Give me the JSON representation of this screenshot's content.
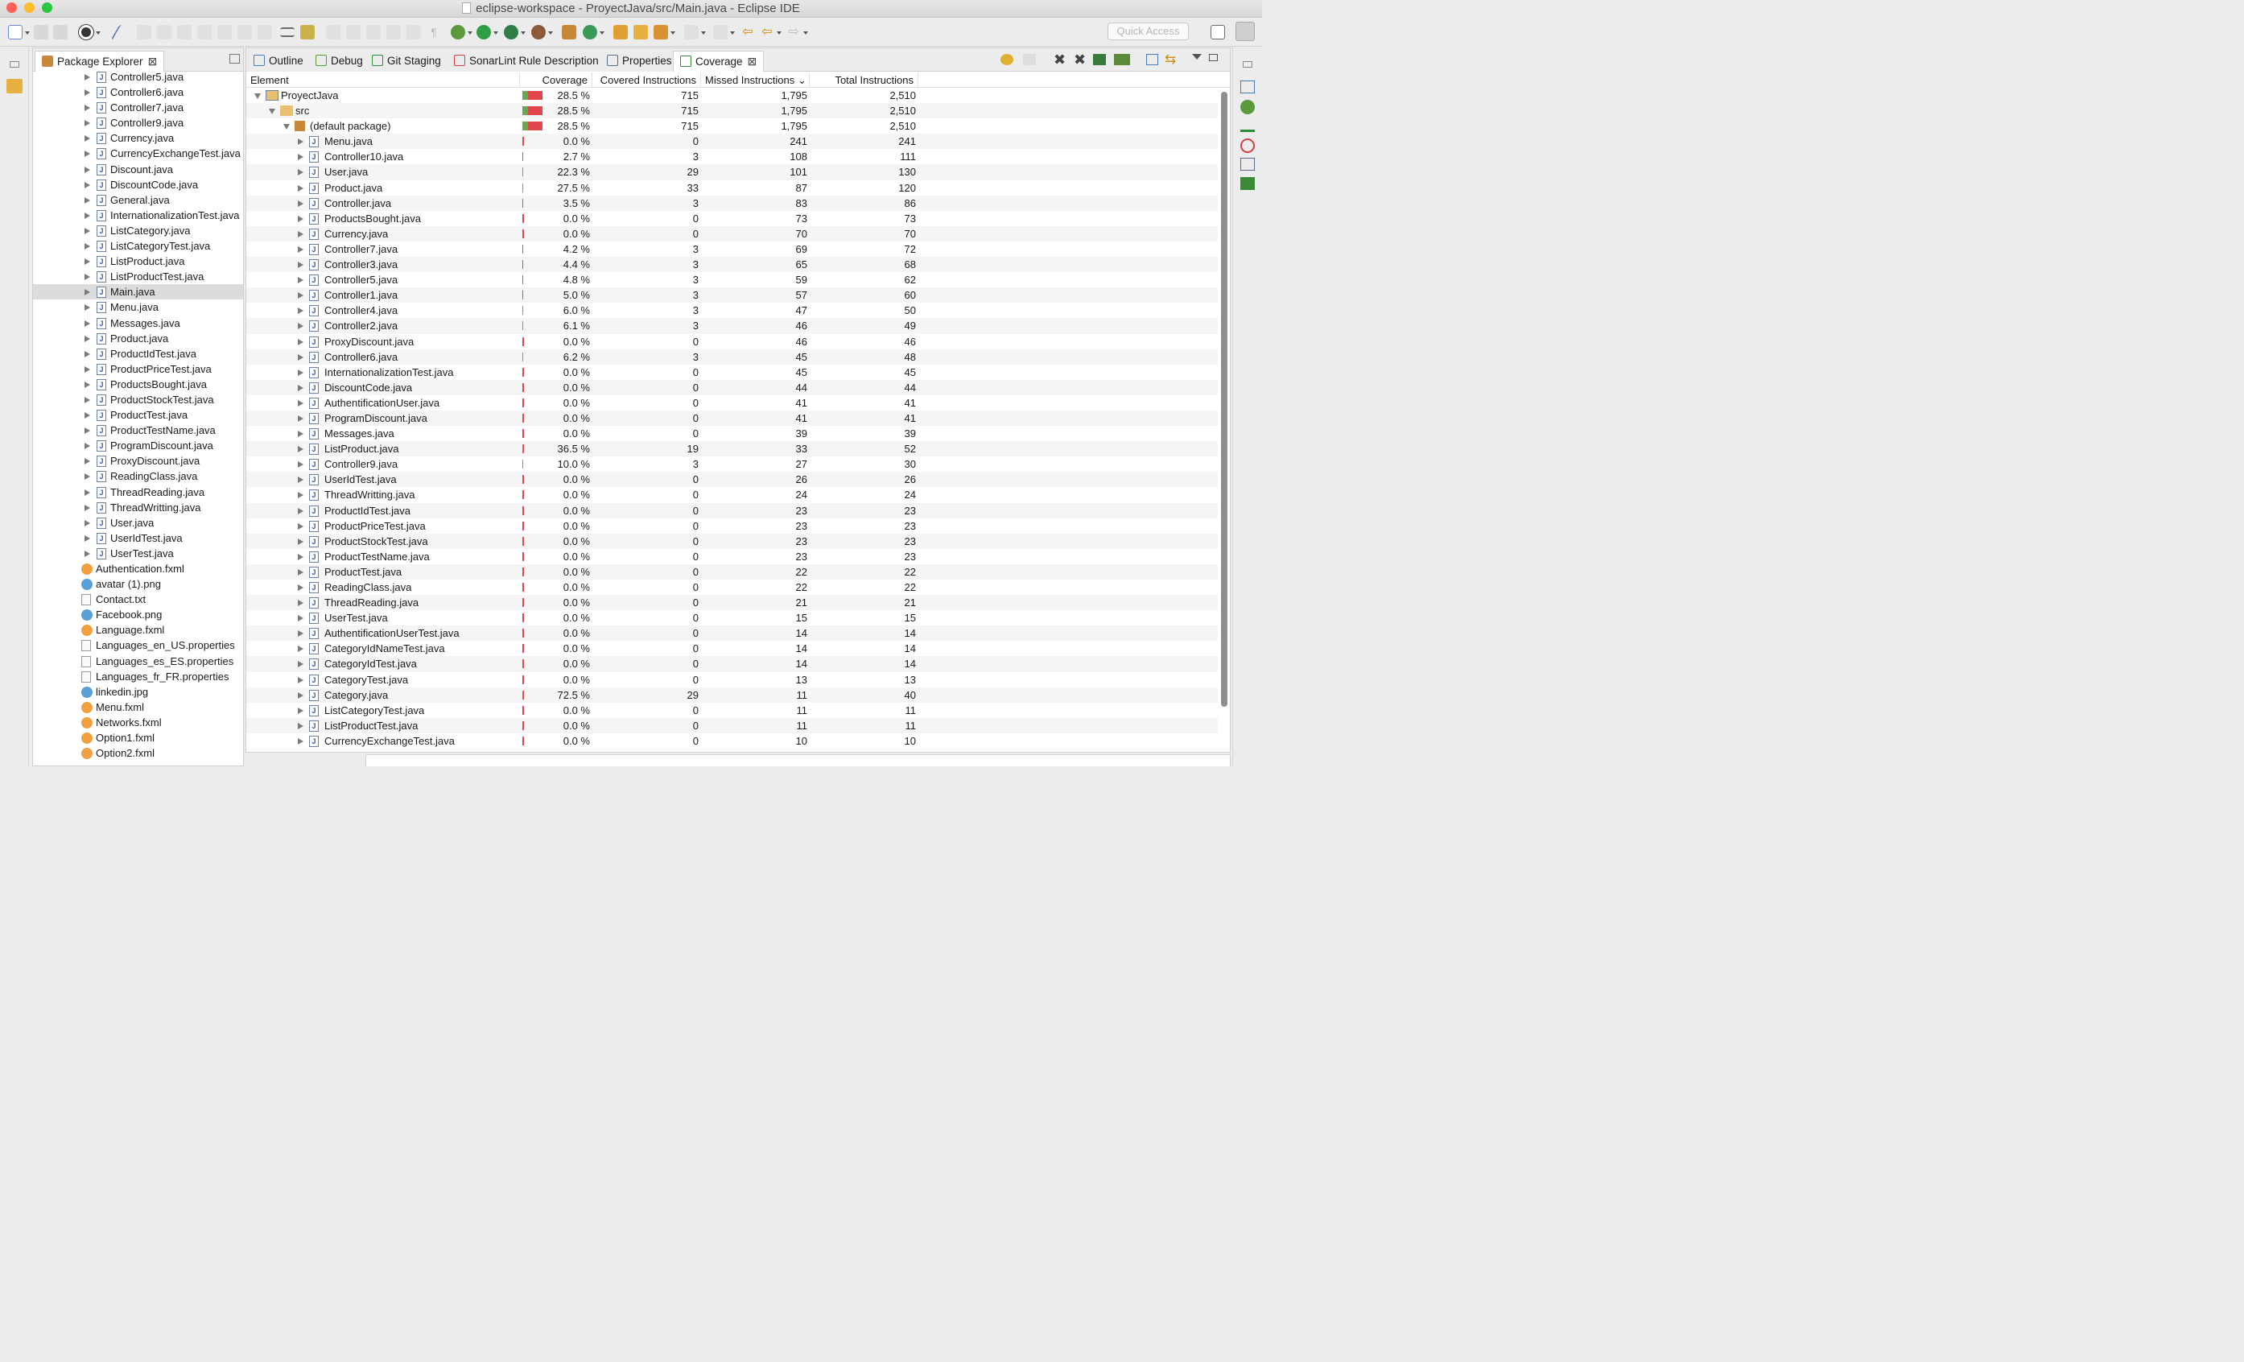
{
  "window": {
    "title": "eclipse-workspace - ProyectJava/src/Main.java - Eclipse IDE"
  },
  "colors": {
    "close": "#fe5f57",
    "minimize": "#febc2e",
    "zoom": "#28c840",
    "bar_red": "#e0474c",
    "bar_green": "#6aa84f"
  },
  "toolbar": {
    "quick_access": "Quick Access"
  },
  "package_explorer": {
    "tab_label": "Package Explorer",
    "items": [
      {
        "label": "Controller5.java",
        "kind": "java",
        "level": 1
      },
      {
        "label": "Controller6.java",
        "kind": "java",
        "level": 1
      },
      {
        "label": "Controller7.java",
        "kind": "java",
        "level": 1
      },
      {
        "label": "Controller9.java",
        "kind": "java",
        "level": 1
      },
      {
        "label": "Currency.java",
        "kind": "java",
        "level": 1
      },
      {
        "label": "CurrencyExchangeTest.java",
        "kind": "java",
        "level": 1
      },
      {
        "label": "Discount.java",
        "kind": "java",
        "level": 1
      },
      {
        "label": "DiscountCode.java",
        "kind": "java",
        "level": 1
      },
      {
        "label": "General.java",
        "kind": "java",
        "level": 1
      },
      {
        "label": "InternationalizationTest.java",
        "kind": "java",
        "level": 1
      },
      {
        "label": "ListCategory.java",
        "kind": "java",
        "level": 1
      },
      {
        "label": "ListCategoryTest.java",
        "kind": "java",
        "level": 1
      },
      {
        "label": "ListProduct.java",
        "kind": "java",
        "level": 1
      },
      {
        "label": "ListProductTest.java",
        "kind": "java",
        "level": 1
      },
      {
        "label": "Main.java",
        "kind": "java",
        "level": 1,
        "selected": true
      },
      {
        "label": "Menu.java",
        "kind": "java",
        "level": 1
      },
      {
        "label": "Messages.java",
        "kind": "java",
        "level": 1
      },
      {
        "label": "Product.java",
        "kind": "java",
        "level": 1
      },
      {
        "label": "ProductIdTest.java",
        "kind": "java",
        "level": 1
      },
      {
        "label": "ProductPriceTest.java",
        "kind": "java",
        "level": 1
      },
      {
        "label": "ProductsBought.java",
        "kind": "java",
        "level": 1
      },
      {
        "label": "ProductStockTest.java",
        "kind": "java",
        "level": 1
      },
      {
        "label": "ProductTest.java",
        "kind": "java",
        "level": 1
      },
      {
        "label": "ProductTestName.java",
        "kind": "java",
        "level": 1
      },
      {
        "label": "ProgramDiscount.java",
        "kind": "java",
        "level": 1
      },
      {
        "label": "ProxyDiscount.java",
        "kind": "java",
        "level": 1
      },
      {
        "label": "ReadingClass.java",
        "kind": "java",
        "level": 1
      },
      {
        "label": "ThreadReading.java",
        "kind": "java",
        "level": 1
      },
      {
        "label": "ThreadWritting.java",
        "kind": "java",
        "level": 1
      },
      {
        "label": "User.java",
        "kind": "java",
        "level": 1
      },
      {
        "label": "UserIdTest.java",
        "kind": "java",
        "level": 1
      },
      {
        "label": "UserTest.java",
        "kind": "java",
        "level": 1
      },
      {
        "label": "Authentication.fxml",
        "kind": "fxml",
        "level": 0
      },
      {
        "label": "avatar (1).png",
        "kind": "image",
        "level": 0
      },
      {
        "label": "Contact.txt",
        "kind": "text",
        "level": 0
      },
      {
        "label": "Facebook.png",
        "kind": "image",
        "level": 0
      },
      {
        "label": "Language.fxml",
        "kind": "fxml",
        "level": 0
      },
      {
        "label": "Languages_en_US.properties",
        "kind": "text",
        "level": 0
      },
      {
        "label": "Languages_es_ES.properties",
        "kind": "text",
        "level": 0
      },
      {
        "label": "Languages_fr_FR.properties",
        "kind": "text",
        "level": 0
      },
      {
        "label": "linkedin.jpg",
        "kind": "image",
        "level": 0
      },
      {
        "label": "Menu.fxml",
        "kind": "fxml",
        "level": 0
      },
      {
        "label": "Networks.fxml",
        "kind": "fxml",
        "level": 0
      },
      {
        "label": "Option1.fxml",
        "kind": "fxml",
        "level": 0
      },
      {
        "label": "Option2.fxml",
        "kind": "fxml",
        "level": 0
      }
    ]
  },
  "view_tabs": [
    {
      "label": "Outline",
      "icon": "outline-icon"
    },
    {
      "label": "Debug",
      "icon": "debug-icon"
    },
    {
      "label": "Git Staging",
      "icon": "git-staging-icon"
    },
    {
      "label": "SonarLint Rule Description",
      "icon": "sonarlint-icon"
    },
    {
      "label": "Properties",
      "icon": "properties-icon"
    },
    {
      "label": "Coverage",
      "icon": "coverage-icon",
      "active": true
    }
  ],
  "coverage": {
    "columns": [
      "Element",
      "Coverage",
      "Covered Instructions",
      "Missed Instructions",
      "Total Instructions"
    ],
    "sort_column": "Missed Instructions",
    "rows": [
      {
        "name": "ProyectJava",
        "kind": "project",
        "depth": 0,
        "expanded": true,
        "coverage": "28.5 %",
        "pct": 28.5,
        "covered": "715",
        "missed": "1,795",
        "total": "2,510",
        "total_n": 2510
      },
      {
        "name": "src",
        "kind": "folder",
        "depth": 1,
        "expanded": true,
        "coverage": "28.5 %",
        "pct": 28.5,
        "covered": "715",
        "missed": "1,795",
        "total": "2,510",
        "total_n": 2510
      },
      {
        "name": "(default package)",
        "kind": "package",
        "depth": 2,
        "expanded": true,
        "coverage": "28.5 %",
        "pct": 28.5,
        "covered": "715",
        "missed": "1,795",
        "total": "2,510",
        "total_n": 2510
      },
      {
        "name": "Menu.java",
        "kind": "java",
        "depth": 3,
        "coverage": "0.0 %",
        "pct": 0,
        "covered": "0",
        "missed": "241",
        "total": "241",
        "total_n": 241
      },
      {
        "name": "Controller10.java",
        "kind": "java",
        "depth": 3,
        "coverage": "2.7 %",
        "pct": 2.7,
        "covered": "3",
        "missed": "108",
        "total": "111",
        "total_n": 111
      },
      {
        "name": "User.java",
        "kind": "java",
        "depth": 3,
        "coverage": "22.3 %",
        "pct": 22.3,
        "covered": "29",
        "missed": "101",
        "total": "130",
        "total_n": 130
      },
      {
        "name": "Product.java",
        "kind": "java",
        "depth": 3,
        "coverage": "27.5 %",
        "pct": 27.5,
        "covered": "33",
        "missed": "87",
        "total": "120",
        "total_n": 120
      },
      {
        "name": "Controller.java",
        "kind": "java",
        "depth": 3,
        "coverage": "3.5 %",
        "pct": 3.5,
        "covered": "3",
        "missed": "83",
        "total": "86",
        "total_n": 86
      },
      {
        "name": "ProductsBought.java",
        "kind": "java",
        "depth": 3,
        "coverage": "0.0 %",
        "pct": 0,
        "covered": "0",
        "missed": "73",
        "total": "73",
        "total_n": 73
      },
      {
        "name": "Currency.java",
        "kind": "java",
        "depth": 3,
        "coverage": "0.0 %",
        "pct": 0,
        "covered": "0",
        "missed": "70",
        "total": "70",
        "total_n": 70
      },
      {
        "name": "Controller7.java",
        "kind": "java",
        "depth": 3,
        "coverage": "4.2 %",
        "pct": 4.2,
        "covered": "3",
        "missed": "69",
        "total": "72",
        "total_n": 72
      },
      {
        "name": "Controller3.java",
        "kind": "java",
        "depth": 3,
        "coverage": "4.4 %",
        "pct": 4.4,
        "covered": "3",
        "missed": "65",
        "total": "68",
        "total_n": 68
      },
      {
        "name": "Controller5.java",
        "kind": "java",
        "depth": 3,
        "coverage": "4.8 %",
        "pct": 4.8,
        "covered": "3",
        "missed": "59",
        "total": "62",
        "total_n": 62
      },
      {
        "name": "Controller1.java",
        "kind": "java",
        "depth": 3,
        "coverage": "5.0 %",
        "pct": 5.0,
        "covered": "3",
        "missed": "57",
        "total": "60",
        "total_n": 60
      },
      {
        "name": "Controller4.java",
        "kind": "java",
        "depth": 3,
        "coverage": "6.0 %",
        "pct": 6.0,
        "covered": "3",
        "missed": "47",
        "total": "50",
        "total_n": 50
      },
      {
        "name": "Controller2.java",
        "kind": "java",
        "depth": 3,
        "coverage": "6.1 %",
        "pct": 6.1,
        "covered": "3",
        "missed": "46",
        "total": "49",
        "total_n": 49
      },
      {
        "name": "ProxyDiscount.java",
        "kind": "java",
        "depth": 3,
        "coverage": "0.0 %",
        "pct": 0,
        "covered": "0",
        "missed": "46",
        "total": "46",
        "total_n": 46
      },
      {
        "name": "Controller6.java",
        "kind": "java",
        "depth": 3,
        "coverage": "6.2 %",
        "pct": 6.2,
        "covered": "3",
        "missed": "45",
        "total": "48",
        "total_n": 48
      },
      {
        "name": "InternationalizationTest.java",
        "kind": "java",
        "depth": 3,
        "coverage": "0.0 %",
        "pct": 0,
        "covered": "0",
        "missed": "45",
        "total": "45",
        "total_n": 45
      },
      {
        "name": "DiscountCode.java",
        "kind": "java",
        "depth": 3,
        "coverage": "0.0 %",
        "pct": 0,
        "covered": "0",
        "missed": "44",
        "total": "44",
        "total_n": 44
      },
      {
        "name": "AuthentificationUser.java",
        "kind": "java",
        "depth": 3,
        "coverage": "0.0 %",
        "pct": 0,
        "covered": "0",
        "missed": "41",
        "total": "41",
        "total_n": 41
      },
      {
        "name": "ProgramDiscount.java",
        "kind": "java",
        "depth": 3,
        "coverage": "0.0 %",
        "pct": 0,
        "covered": "0",
        "missed": "41",
        "total": "41",
        "total_n": 41
      },
      {
        "name": "Messages.java",
        "kind": "java",
        "depth": 3,
        "coverage": "0.0 %",
        "pct": 0,
        "covered": "0",
        "missed": "39",
        "total": "39",
        "total_n": 39
      },
      {
        "name": "ListProduct.java",
        "kind": "java",
        "depth": 3,
        "coverage": "36.5 %",
        "pct": 36.5,
        "covered": "19",
        "missed": "33",
        "total": "52",
        "total_n": 52
      },
      {
        "name": "Controller9.java",
        "kind": "java",
        "depth": 3,
        "coverage": "10.0 %",
        "pct": 10.0,
        "covered": "3",
        "missed": "27",
        "total": "30",
        "total_n": 30
      },
      {
        "name": "UserIdTest.java",
        "kind": "java",
        "depth": 3,
        "coverage": "0.0 %",
        "pct": 0,
        "covered": "0",
        "missed": "26",
        "total": "26",
        "total_n": 26
      },
      {
        "name": "ThreadWritting.java",
        "kind": "java",
        "depth": 3,
        "coverage": "0.0 %",
        "pct": 0,
        "covered": "0",
        "missed": "24",
        "total": "24",
        "total_n": 24
      },
      {
        "name": "ProductIdTest.java",
        "kind": "java",
        "depth": 3,
        "coverage": "0.0 %",
        "pct": 0,
        "covered": "0",
        "missed": "23",
        "total": "23",
        "total_n": 23
      },
      {
        "name": "ProductPriceTest.java",
        "kind": "java",
        "depth": 3,
        "coverage": "0.0 %",
        "pct": 0,
        "covered": "0",
        "missed": "23",
        "total": "23",
        "total_n": 23
      },
      {
        "name": "ProductStockTest.java",
        "kind": "java",
        "depth": 3,
        "coverage": "0.0 %",
        "pct": 0,
        "covered": "0",
        "missed": "23",
        "total": "23",
        "total_n": 23
      },
      {
        "name": "ProductTestName.java",
        "kind": "java",
        "depth": 3,
        "coverage": "0.0 %",
        "pct": 0,
        "covered": "0",
        "missed": "23",
        "total": "23",
        "total_n": 23
      },
      {
        "name": "ProductTest.java",
        "kind": "java",
        "depth": 3,
        "coverage": "0.0 %",
        "pct": 0,
        "covered": "0",
        "missed": "22",
        "total": "22",
        "total_n": 22
      },
      {
        "name": "ReadingClass.java",
        "kind": "java",
        "depth": 3,
        "coverage": "0.0 %",
        "pct": 0,
        "covered": "0",
        "missed": "22",
        "total": "22",
        "total_n": 22
      },
      {
        "name": "ThreadReading.java",
        "kind": "java",
        "depth": 3,
        "coverage": "0.0 %",
        "pct": 0,
        "covered": "0",
        "missed": "21",
        "total": "21",
        "total_n": 21
      },
      {
        "name": "UserTest.java",
        "kind": "java",
        "depth": 3,
        "coverage": "0.0 %",
        "pct": 0,
        "covered": "0",
        "missed": "15",
        "total": "15",
        "total_n": 15
      },
      {
        "name": "AuthentificationUserTest.java",
        "kind": "java",
        "depth": 3,
        "coverage": "0.0 %",
        "pct": 0,
        "covered": "0",
        "missed": "14",
        "total": "14",
        "total_n": 14
      },
      {
        "name": "CategoryIdNameTest.java",
        "kind": "java",
        "depth": 3,
        "coverage": "0.0 %",
        "pct": 0,
        "covered": "0",
        "missed": "14",
        "total": "14",
        "total_n": 14
      },
      {
        "name": "CategoryIdTest.java",
        "kind": "java",
        "depth": 3,
        "coverage": "0.0 %",
        "pct": 0,
        "covered": "0",
        "missed": "14",
        "total": "14",
        "total_n": 14
      },
      {
        "name": "CategoryTest.java",
        "kind": "java",
        "depth": 3,
        "coverage": "0.0 %",
        "pct": 0,
        "covered": "0",
        "missed": "13",
        "total": "13",
        "total_n": 13
      },
      {
        "name": "Category.java",
        "kind": "java",
        "depth": 3,
        "coverage": "72.5 %",
        "pct": 72.5,
        "covered": "29",
        "missed": "11",
        "total": "40",
        "total_n": 40
      },
      {
        "name": "ListCategoryTest.java",
        "kind": "java",
        "depth": 3,
        "coverage": "0.0 %",
        "pct": 0,
        "covered": "0",
        "missed": "11",
        "total": "11",
        "total_n": 11
      },
      {
        "name": "ListProductTest.java",
        "kind": "java",
        "depth": 3,
        "coverage": "0.0 %",
        "pct": 0,
        "covered": "0",
        "missed": "11",
        "total": "11",
        "total_n": 11
      },
      {
        "name": "CurrencyExchangeTest.java",
        "kind": "java",
        "depth": 3,
        "coverage": "0.0 %",
        "pct": 0,
        "covered": "0",
        "missed": "10",
        "total": "10",
        "total_n": 10
      }
    ]
  }
}
